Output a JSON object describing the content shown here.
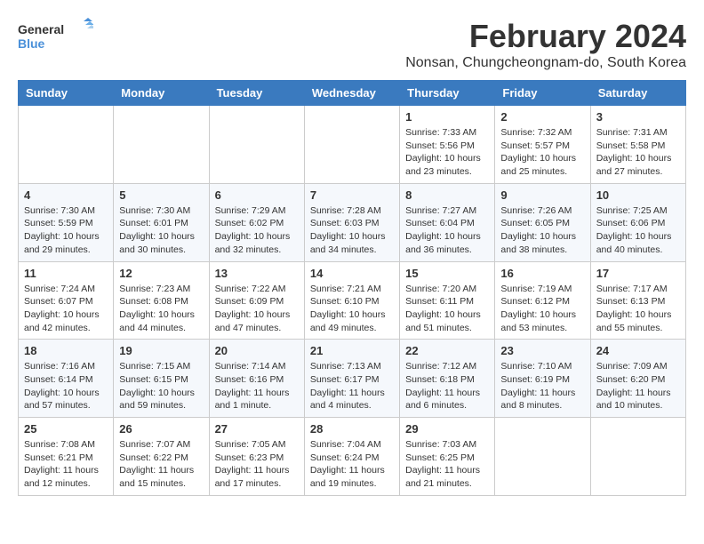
{
  "logo": {
    "line1": "General",
    "line2": "Blue"
  },
  "title": "February 2024",
  "subtitle": "Nonsan, Chungcheongnam-do, South Korea",
  "days_of_week": [
    "Sunday",
    "Monday",
    "Tuesday",
    "Wednesday",
    "Thursday",
    "Friday",
    "Saturday"
  ],
  "weeks": [
    [
      {
        "day": "",
        "info": ""
      },
      {
        "day": "",
        "info": ""
      },
      {
        "day": "",
        "info": ""
      },
      {
        "day": "",
        "info": ""
      },
      {
        "day": "1",
        "info": "Sunrise: 7:33 AM\nSunset: 5:56 PM\nDaylight: 10 hours\nand 23 minutes."
      },
      {
        "day": "2",
        "info": "Sunrise: 7:32 AM\nSunset: 5:57 PM\nDaylight: 10 hours\nand 25 minutes."
      },
      {
        "day": "3",
        "info": "Sunrise: 7:31 AM\nSunset: 5:58 PM\nDaylight: 10 hours\nand 27 minutes."
      }
    ],
    [
      {
        "day": "4",
        "info": "Sunrise: 7:30 AM\nSunset: 5:59 PM\nDaylight: 10 hours\nand 29 minutes."
      },
      {
        "day": "5",
        "info": "Sunrise: 7:30 AM\nSunset: 6:01 PM\nDaylight: 10 hours\nand 30 minutes."
      },
      {
        "day": "6",
        "info": "Sunrise: 7:29 AM\nSunset: 6:02 PM\nDaylight: 10 hours\nand 32 minutes."
      },
      {
        "day": "7",
        "info": "Sunrise: 7:28 AM\nSunset: 6:03 PM\nDaylight: 10 hours\nand 34 minutes."
      },
      {
        "day": "8",
        "info": "Sunrise: 7:27 AM\nSunset: 6:04 PM\nDaylight: 10 hours\nand 36 minutes."
      },
      {
        "day": "9",
        "info": "Sunrise: 7:26 AM\nSunset: 6:05 PM\nDaylight: 10 hours\nand 38 minutes."
      },
      {
        "day": "10",
        "info": "Sunrise: 7:25 AM\nSunset: 6:06 PM\nDaylight: 10 hours\nand 40 minutes."
      }
    ],
    [
      {
        "day": "11",
        "info": "Sunrise: 7:24 AM\nSunset: 6:07 PM\nDaylight: 10 hours\nand 42 minutes."
      },
      {
        "day": "12",
        "info": "Sunrise: 7:23 AM\nSunset: 6:08 PM\nDaylight: 10 hours\nand 44 minutes."
      },
      {
        "day": "13",
        "info": "Sunrise: 7:22 AM\nSunset: 6:09 PM\nDaylight: 10 hours\nand 47 minutes."
      },
      {
        "day": "14",
        "info": "Sunrise: 7:21 AM\nSunset: 6:10 PM\nDaylight: 10 hours\nand 49 minutes."
      },
      {
        "day": "15",
        "info": "Sunrise: 7:20 AM\nSunset: 6:11 PM\nDaylight: 10 hours\nand 51 minutes."
      },
      {
        "day": "16",
        "info": "Sunrise: 7:19 AM\nSunset: 6:12 PM\nDaylight: 10 hours\nand 53 minutes."
      },
      {
        "day": "17",
        "info": "Sunrise: 7:17 AM\nSunset: 6:13 PM\nDaylight: 10 hours\nand 55 minutes."
      }
    ],
    [
      {
        "day": "18",
        "info": "Sunrise: 7:16 AM\nSunset: 6:14 PM\nDaylight: 10 hours\nand 57 minutes."
      },
      {
        "day": "19",
        "info": "Sunrise: 7:15 AM\nSunset: 6:15 PM\nDaylight: 10 hours\nand 59 minutes."
      },
      {
        "day": "20",
        "info": "Sunrise: 7:14 AM\nSunset: 6:16 PM\nDaylight: 11 hours\nand 1 minute."
      },
      {
        "day": "21",
        "info": "Sunrise: 7:13 AM\nSunset: 6:17 PM\nDaylight: 11 hours\nand 4 minutes."
      },
      {
        "day": "22",
        "info": "Sunrise: 7:12 AM\nSunset: 6:18 PM\nDaylight: 11 hours\nand 6 minutes."
      },
      {
        "day": "23",
        "info": "Sunrise: 7:10 AM\nSunset: 6:19 PM\nDaylight: 11 hours\nand 8 minutes."
      },
      {
        "day": "24",
        "info": "Sunrise: 7:09 AM\nSunset: 6:20 PM\nDaylight: 11 hours\nand 10 minutes."
      }
    ],
    [
      {
        "day": "25",
        "info": "Sunrise: 7:08 AM\nSunset: 6:21 PM\nDaylight: 11 hours\nand 12 minutes."
      },
      {
        "day": "26",
        "info": "Sunrise: 7:07 AM\nSunset: 6:22 PM\nDaylight: 11 hours\nand 15 minutes."
      },
      {
        "day": "27",
        "info": "Sunrise: 7:05 AM\nSunset: 6:23 PM\nDaylight: 11 hours\nand 17 minutes."
      },
      {
        "day": "28",
        "info": "Sunrise: 7:04 AM\nSunset: 6:24 PM\nDaylight: 11 hours\nand 19 minutes."
      },
      {
        "day": "29",
        "info": "Sunrise: 7:03 AM\nSunset: 6:25 PM\nDaylight: 11 hours\nand 21 minutes."
      },
      {
        "day": "",
        "info": ""
      },
      {
        "day": "",
        "info": ""
      }
    ]
  ]
}
